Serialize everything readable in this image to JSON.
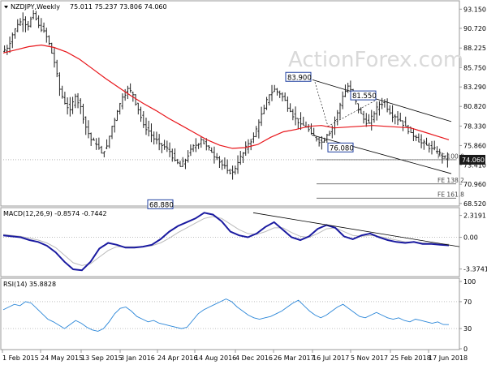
{
  "chart_data": [
    {
      "type": "candlestick",
      "title": "NZDJPY,Weekly",
      "ohlc_label": "75.011 75.237 73.806 74.060",
      "last_price": "74.060",
      "watermark": "ActionForex.com",
      "ylim": [
        68.4,
        93.9
      ],
      "y_ticks": [
        "93.150",
        "90.720",
        "88.225",
        "85.750",
        "83.290",
        "80.820",
        "78.330",
        "75.860",
        "73.410",
        "70.960",
        "68.520"
      ],
      "x_ticks": [
        "1 Feb 2015",
        "24 May 2015",
        "13 Sep 2015",
        "3 Jan 2016",
        "24 Apr 2016",
        "14 Aug 2016",
        "4 Dec 2016",
        "26 Mar 2017",
        "16 Jul 2017",
        "5 Nov 2017",
        "25 Feb 2018",
        "17 Jun 2018"
      ],
      "close_series": [
        88.2,
        89.9,
        91.2,
        91.8,
        91.0,
        92.6,
        91.1,
        90.4,
        88.8,
        86.4,
        83.0,
        81.2,
        80.4,
        82.1,
        80.8,
        78.2,
        76.6,
        76.0,
        74.9,
        75.8,
        78.3,
        80.2,
        82.0,
        83.1,
        82.3,
        80.4,
        78.5,
        77.7,
        76.7,
        76.1,
        75.7,
        75.1,
        74.0,
        73.2,
        74.0,
        75.4,
        75.9,
        76.6,
        75.8,
        75.0,
        74.3,
        73.4,
        72.7,
        72.5,
        73.7,
        74.9,
        76.1,
        77.0,
        78.8,
        80.6,
        82.3,
        83.0,
        82.4,
        81.6,
        80.2,
        79.3,
        78.6,
        78.2,
        77.4,
        76.7,
        76.3,
        77.2,
        78.1,
        80.0,
        82.1,
        83.4,
        82.2,
        80.4,
        79.2,
        78.7,
        79.9,
        81.1,
        81.4,
        80.0,
        79.5,
        79.0,
        78.3,
        77.5,
        76.9,
        76.2,
        75.9,
        75.5,
        75.1,
        74.5,
        74.06
      ],
      "ma_series": [
        87.6,
        88.0,
        88.4,
        88.6,
        88.3,
        87.7,
        86.8,
        85.6,
        84.4,
        83.3,
        82.2,
        81.2,
        80.3,
        79.3,
        78.4,
        77.5,
        76.6,
        75.9,
        75.5,
        75.6,
        76.0,
        76.9,
        77.6,
        77.9,
        78.3,
        78.4,
        78.1,
        78.2,
        78.3,
        78.4,
        78.3,
        78.2,
        78.1,
        77.6,
        77.1,
        76.6
      ],
      "annotations": [
        {
          "label": "83.900",
          "value": 83.9
        },
        {
          "label": "81.550",
          "value": 81.55
        },
        {
          "label": "76.080",
          "value": 76.08
        },
        {
          "label": "68.880",
          "value": 68.88
        }
      ],
      "fibonacci_extensions": [
        {
          "label": "FE 100.0",
          "value": 74.06
        },
        {
          "label": "FE 138.2",
          "value": 71.0
        },
        {
          "label": "FE 161.8",
          "value": 69.2
        }
      ],
      "colors": {
        "ma": "#e8151a",
        "channel": "#000000",
        "annotation_border": "#1f3fa0",
        "candle": "#222222"
      }
    },
    {
      "type": "line",
      "title": "MACD(12,26,9) -0.8574 -0.7442",
      "ylim": [
        -4.0,
        2.8
      ],
      "y_ticks": [
        "2.3191",
        "0.00",
        "-3.3741"
      ],
      "series": [
        {
          "values": [
            0.2,
            0.1,
            0.0,
            -0.3,
            -0.5,
            -0.9,
            -1.6,
            -2.6,
            -3.4,
            -3.5,
            -2.6,
            -1.2,
            -0.6,
            -0.8,
            -1.1,
            -1.1,
            -1.0,
            -0.8,
            -0.2,
            0.6,
            1.2,
            1.6,
            2.0,
            2.6,
            2.4,
            1.7,
            0.6,
            0.2,
            0.0,
            0.4,
            1.1,
            1.6,
            0.8,
            0.0,
            -0.3,
            0.1,
            0.9,
            1.3,
            1.0,
            0.1,
            -0.2,
            0.2,
            0.4,
            0.0,
            -0.3,
            -0.5,
            -0.6,
            -0.5,
            -0.7,
            -0.7,
            -0.8,
            -0.86
          ],
          "color": "#1a1aa0"
        },
        {
          "values": [
            0.3,
            0.2,
            0.1,
            -0.1,
            -0.3,
            -0.6,
            -1.1,
            -1.9,
            -2.7,
            -3.0,
            -2.8,
            -2.1,
            -1.4,
            -1.0,
            -1.0,
            -1.0,
            -1.0,
            -0.9,
            -0.6,
            -0.1,
            0.5,
            1.0,
            1.5,
            2.0,
            2.2,
            2.0,
            1.4,
            0.8,
            0.4,
            0.3,
            0.6,
            1.0,
            1.0,
            0.5,
            0.1,
            0.0,
            0.4,
            0.9,
            1.0,
            0.6,
            0.2,
            0.1,
            0.2,
            0.1,
            -0.1,
            -0.3,
            -0.5,
            -0.5,
            -0.6,
            -0.6,
            -0.7,
            -0.74
          ],
          "color": "#bbbbbb"
        }
      ]
    },
    {
      "type": "line",
      "title": "RSI(14) 35.8828",
      "ylim": [
        0,
        100
      ],
      "y_ticks": [
        "100",
        "70",
        "30",
        "0"
      ],
      "series": [
        {
          "values": [
            58,
            62,
            66,
            64,
            70,
            68,
            60,
            52,
            44,
            40,
            35,
            30,
            36,
            42,
            38,
            32,
            28,
            26,
            30,
            40,
            52,
            60,
            62,
            56,
            48,
            44,
            40,
            42,
            38,
            36,
            34,
            32,
            30,
            32,
            42,
            52,
            58,
            62,
            66,
            70,
            74,
            70,
            62,
            56,
            50,
            46,
            44,
            46,
            48,
            52,
            56,
            62,
            68,
            72,
            64,
            56,
            50,
            46,
            50,
            56,
            62,
            66,
            60,
            54,
            48,
            46,
            50,
            54,
            50,
            46,
            44,
            46,
            42,
            40,
            44,
            42,
            40,
            38,
            40,
            36,
            35.9
          ],
          "color": "#2a86d8"
        }
      ]
    }
  ]
}
